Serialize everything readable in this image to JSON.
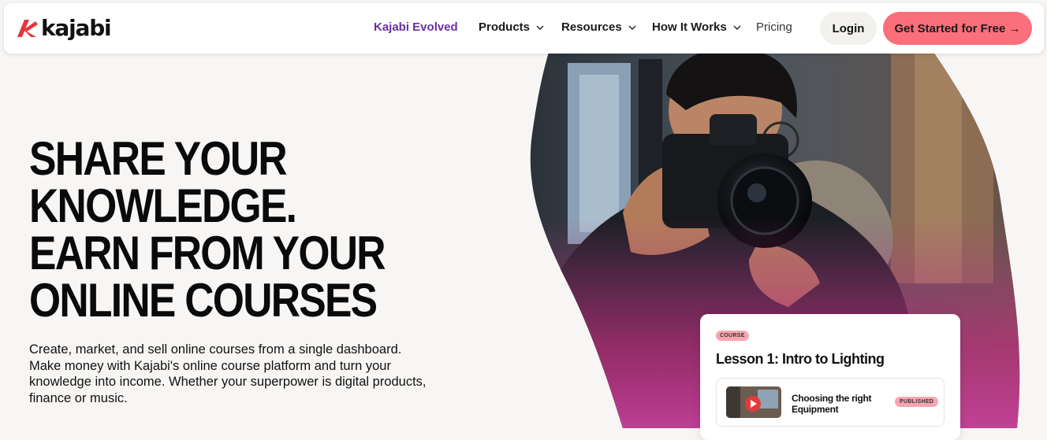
{
  "brand": {
    "name": "kajabi",
    "accent": "#fb6f7a",
    "logo_color": "#e8343a"
  },
  "nav": {
    "evolved": "Kajabi Evolved",
    "products": "Products",
    "resources": "Resources",
    "how_it_works": "How It Works",
    "pricing": "Pricing",
    "login": "Login",
    "cta": "Get Started for Free →"
  },
  "hero": {
    "title": "SHARE YOUR KNOWLEDGE. EARN FROM YOUR ONLINE COURSES",
    "description": "Create, market, and sell online courses from a single dashboard. Make money with Kajabi's online course platform and turn your knowledge into income. Whether your superpower is digital products, finance or music."
  },
  "course_card": {
    "badge": "COURSE",
    "title": "Lesson 1: Intro to Lighting",
    "lesson": {
      "title": "Choosing the right Equipment",
      "status": "PUBLISHED"
    }
  }
}
